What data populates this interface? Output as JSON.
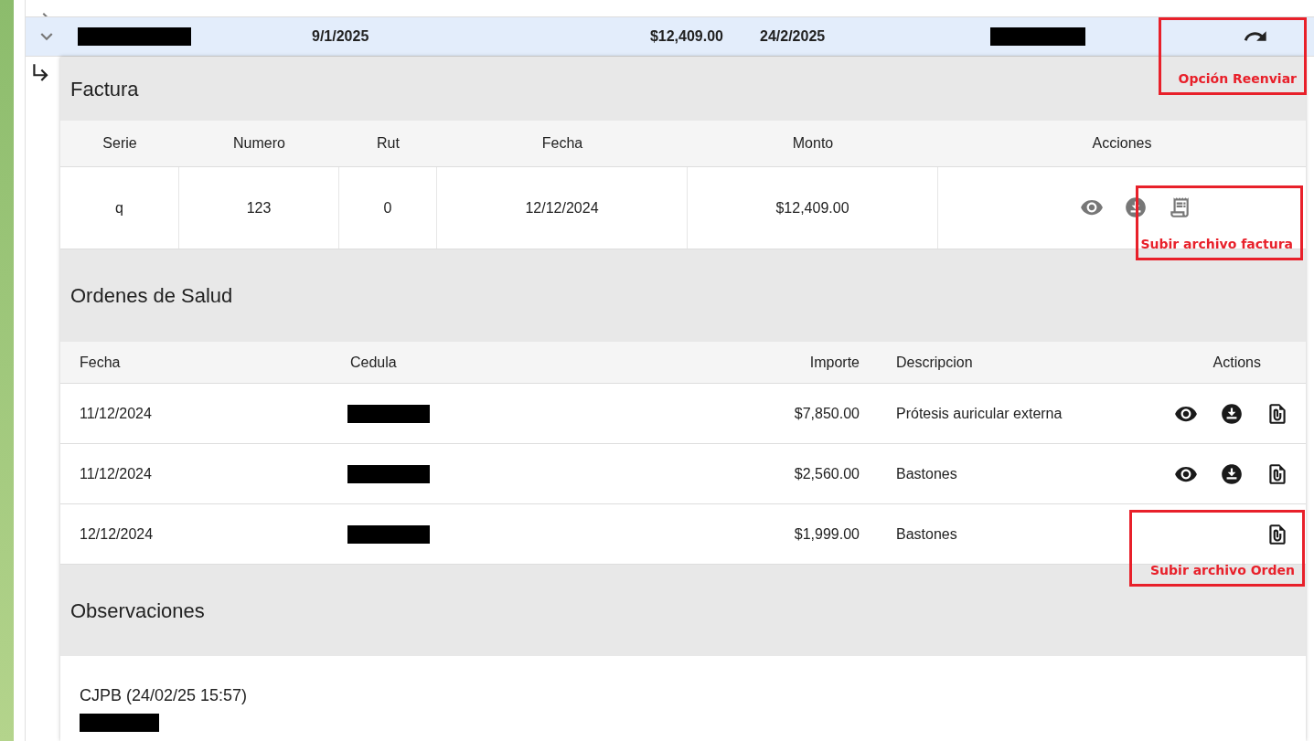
{
  "main_rows": [
    {
      "expanded": false
    },
    {
      "expanded": true,
      "date": "9/1/2025",
      "amount": "$12,409.00",
      "due_date": "24/2/2025",
      "annotation": "Opción Reenviar"
    }
  ],
  "factura": {
    "title": "Factura",
    "columns": [
      "Serie",
      "Numero",
      "Rut",
      "Fecha",
      "Monto",
      "Acciones"
    ],
    "rows": [
      {
        "cells": [
          "q",
          "123",
          "0",
          "12/12/2024",
          "$12,409.00"
        ],
        "actions": [
          {
            "kind": "view"
          },
          {
            "kind": "download"
          },
          {
            "kind": "receipt"
          }
        ],
        "annotation": "Subir archivo factura"
      }
    ]
  },
  "ordenes": {
    "title": "Ordenes de Salud",
    "columns": [
      "Fecha",
      "Cedula",
      "Importe",
      "Descripcion",
      "Actions"
    ],
    "rows": [
      {
        "fecha": "11/12/2024",
        "importe": "$7,850.00",
        "descripcion": "Prótesis auricular externa",
        "actions": [
          {
            "kind": "view"
          },
          {
            "kind": "download"
          },
          {
            "kind": "attach"
          }
        ]
      },
      {
        "fecha": "11/12/2024",
        "importe": "$2,560.00",
        "descripcion": "Bastones",
        "actions": [
          {
            "kind": "view"
          },
          {
            "kind": "download"
          },
          {
            "kind": "attach"
          }
        ]
      },
      {
        "fecha": "12/12/2024",
        "importe": "$1,999.00",
        "descripcion": "Bastones",
        "actions": [
          {
            "kind": "attach"
          }
        ],
        "annotation": "Subir archivo Orden"
      }
    ]
  },
  "observaciones": {
    "title": "Observaciones",
    "entries": [
      {
        "header": "CJPB (24/02/25 15:57)"
      }
    ]
  }
}
